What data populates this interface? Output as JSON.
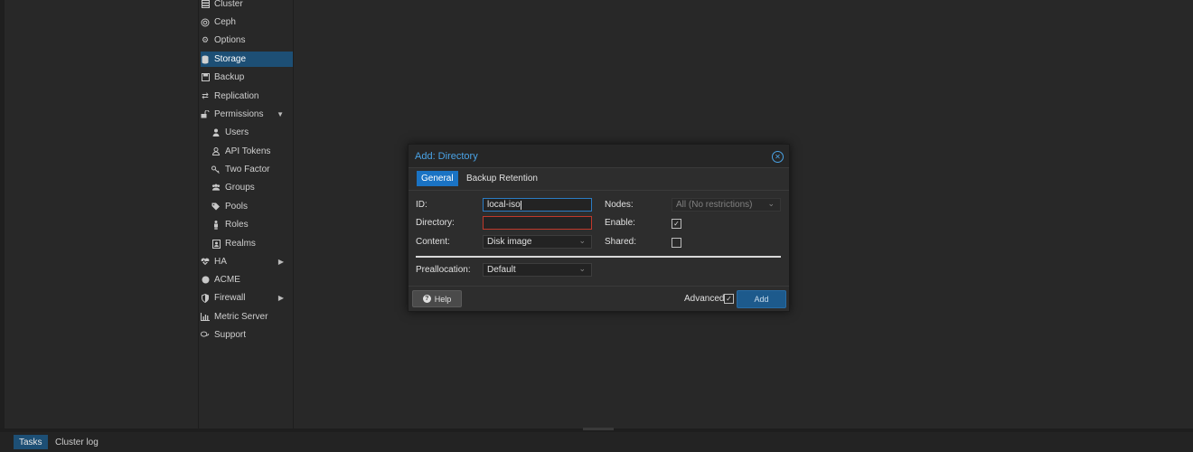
{
  "nav": {
    "items": [
      {
        "label": "Cluster",
        "icon": "server-icon"
      },
      {
        "label": "Ceph",
        "icon": "ceph-icon"
      },
      {
        "label": "Options",
        "icon": "gear-icon"
      },
      {
        "label": "Storage",
        "icon": "database-icon",
        "active": true
      },
      {
        "label": "Backup",
        "icon": "floppy-icon"
      },
      {
        "label": "Replication",
        "icon": "retweet-icon"
      },
      {
        "label": "Permissions",
        "icon": "unlock-icon",
        "expandable": "down"
      },
      {
        "label": "Users",
        "icon": "user-icon",
        "indent": true
      },
      {
        "label": "API Tokens",
        "icon": "user-outline-icon",
        "indent": true
      },
      {
        "label": "Two Factor",
        "icon": "key-icon",
        "indent": true
      },
      {
        "label": "Groups",
        "icon": "users-icon",
        "indent": true
      },
      {
        "label": "Pools",
        "icon": "tags-icon",
        "indent": true
      },
      {
        "label": "Roles",
        "icon": "male-icon",
        "indent": true
      },
      {
        "label": "Realms",
        "icon": "address-book-icon",
        "indent": true
      },
      {
        "label": "HA",
        "icon": "heartbeat-icon",
        "expandable": "right"
      },
      {
        "label": "ACME",
        "icon": "certificate-icon"
      },
      {
        "label": "Firewall",
        "icon": "shield-icon",
        "expandable": "right"
      },
      {
        "label": "Metric Server",
        "icon": "bar-chart-icon"
      },
      {
        "label": "Support",
        "icon": "comments-icon"
      }
    ]
  },
  "dialog": {
    "title": "Add: Directory",
    "tabs": [
      {
        "label": "General",
        "active": true
      },
      {
        "label": "Backup Retention",
        "active": false
      }
    ],
    "fields": {
      "id_label": "ID:",
      "id_value": "local-iso",
      "directory_label": "Directory:",
      "directory_value": "",
      "content_label": "Content:",
      "content_value": "Disk image",
      "nodes_label": "Nodes:",
      "nodes_value": "All (No restrictions)",
      "enable_label": "Enable:",
      "enable_checked": true,
      "shared_label": "Shared:",
      "shared_checked": false,
      "prealloc_label": "Preallocation:",
      "prealloc_value": "Default"
    },
    "footer": {
      "help_label": "Help",
      "advanced_label": "Advanced",
      "advanced_checked": true,
      "add_label": "Add"
    }
  },
  "bottom": {
    "tabs": [
      {
        "label": "Tasks",
        "active": true
      },
      {
        "label": "Cluster log",
        "active": false
      }
    ]
  },
  "colors": {
    "accent": "#4aa3e6",
    "active_tab": "#1a73c4",
    "selected_nav": "#1d4f75",
    "invalid_border": "#c0392b"
  }
}
